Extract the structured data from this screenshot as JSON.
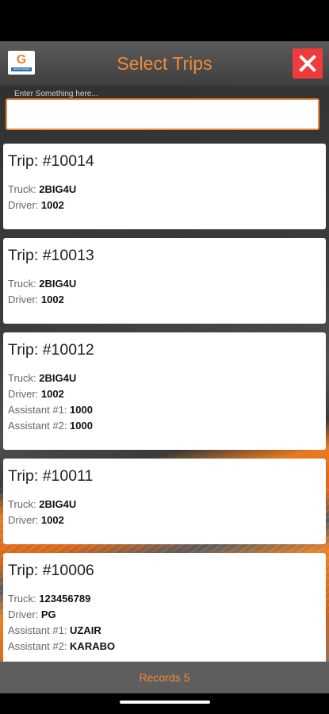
{
  "header": {
    "title": "Select Trips",
    "logo_text": "G",
    "logo_caption": "DEVELOPERS"
  },
  "search": {
    "label": "Enter Something here...",
    "value": ""
  },
  "trips": [
    {
      "trip": "Trip: #10014",
      "fields": [
        {
          "label": "Truck: ",
          "value": "2BIG4U"
        },
        {
          "label": "Driver: ",
          "value": "1002"
        }
      ]
    },
    {
      "trip": "Trip: #10013",
      "fields": [
        {
          "label": "Truck: ",
          "value": "2BIG4U"
        },
        {
          "label": "Driver: ",
          "value": "1002"
        }
      ]
    },
    {
      "trip": "Trip: #10012",
      "fields": [
        {
          "label": "Truck: ",
          "value": "2BIG4U"
        },
        {
          "label": "Driver: ",
          "value": "1002"
        },
        {
          "label": "Assistant #1: ",
          "value": "1000"
        },
        {
          "label": "Assistant #2: ",
          "value": "1000"
        }
      ]
    },
    {
      "trip": "Trip: #10011",
      "fields": [
        {
          "label": "Truck: ",
          "value": "2BIG4U"
        },
        {
          "label": "Driver: ",
          "value": "1002"
        }
      ]
    },
    {
      "trip": "Trip: #10006",
      "fields": [
        {
          "label": "Truck: ",
          "value": "123456789"
        },
        {
          "label": "Driver: ",
          "value": "PG"
        },
        {
          "label": "Assistant #1: ",
          "value": "UZAIR"
        },
        {
          "label": "Assistant #2: ",
          "value": "KARABO"
        }
      ]
    }
  ],
  "footer": {
    "records": "Records 5"
  },
  "colors": {
    "accent": "#ef8a3c",
    "close": "#ef3b3b"
  },
  "icons": {
    "close": "close-icon",
    "logo": "app-logo"
  }
}
